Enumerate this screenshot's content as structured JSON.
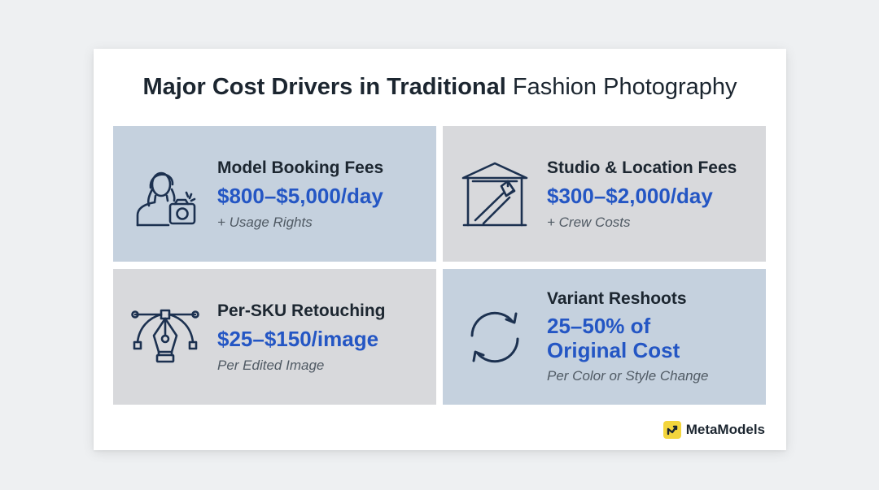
{
  "title": {
    "bold": "Major Cost Drivers in Traditional",
    "light": "Fashion Photography"
  },
  "tiles": [
    {
      "heading": "Model Booking Fees",
      "value": "$800–$5,000/day",
      "note": "+ Usage Rights",
      "icon": "model-camera-icon"
    },
    {
      "heading": "Studio & Location Fees",
      "value": "$300–$2,000/day",
      "note": "+ Crew Costs",
      "icon": "studio-spotlight-icon"
    },
    {
      "heading": "Per-SKU Retouching",
      "value": "$25–$150/image",
      "note": "Per Edited Image",
      "icon": "pen-tool-icon"
    },
    {
      "heading": "Variant Reshoots",
      "value": "25–50% of Original Cost",
      "note": "Per Color or Style Change",
      "icon": "refresh-icon"
    }
  ],
  "brand": {
    "name": "MetaModels"
  },
  "colors": {
    "accent": "#2456c4",
    "tile_blue": "#c5d1de",
    "tile_gray": "#d8d9dc",
    "heading": "#1c2630",
    "logo": "#f3d53c"
  }
}
